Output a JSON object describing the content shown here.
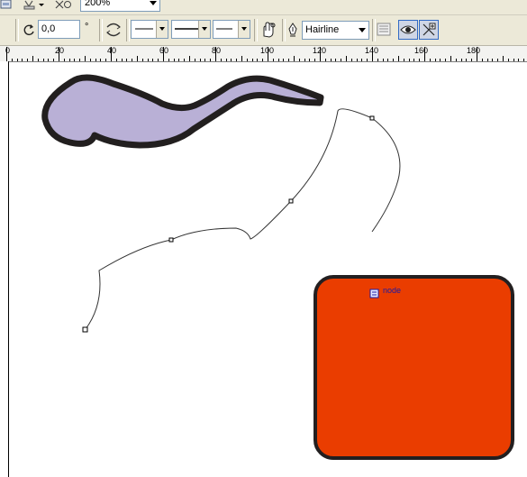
{
  "toolbar": {
    "zoom_value": "200%"
  },
  "property_bar": {
    "rotation_value": "0,0",
    "degree_symbol": "°",
    "outline_width": "Hairline"
  },
  "ruler": {
    "labels": [
      "0",
      "20",
      "40",
      "60",
      "80",
      "100",
      "120",
      "140",
      "160",
      "180"
    ]
  },
  "canvas": {
    "cursor_tooltip": "node",
    "colors": {
      "wave_fill": "#b9b0d6",
      "wave_outline": "#221f1f",
      "rect_fill": "#ea3d00",
      "rect_outline": "#231f20",
      "curve": "#333333"
    }
  }
}
